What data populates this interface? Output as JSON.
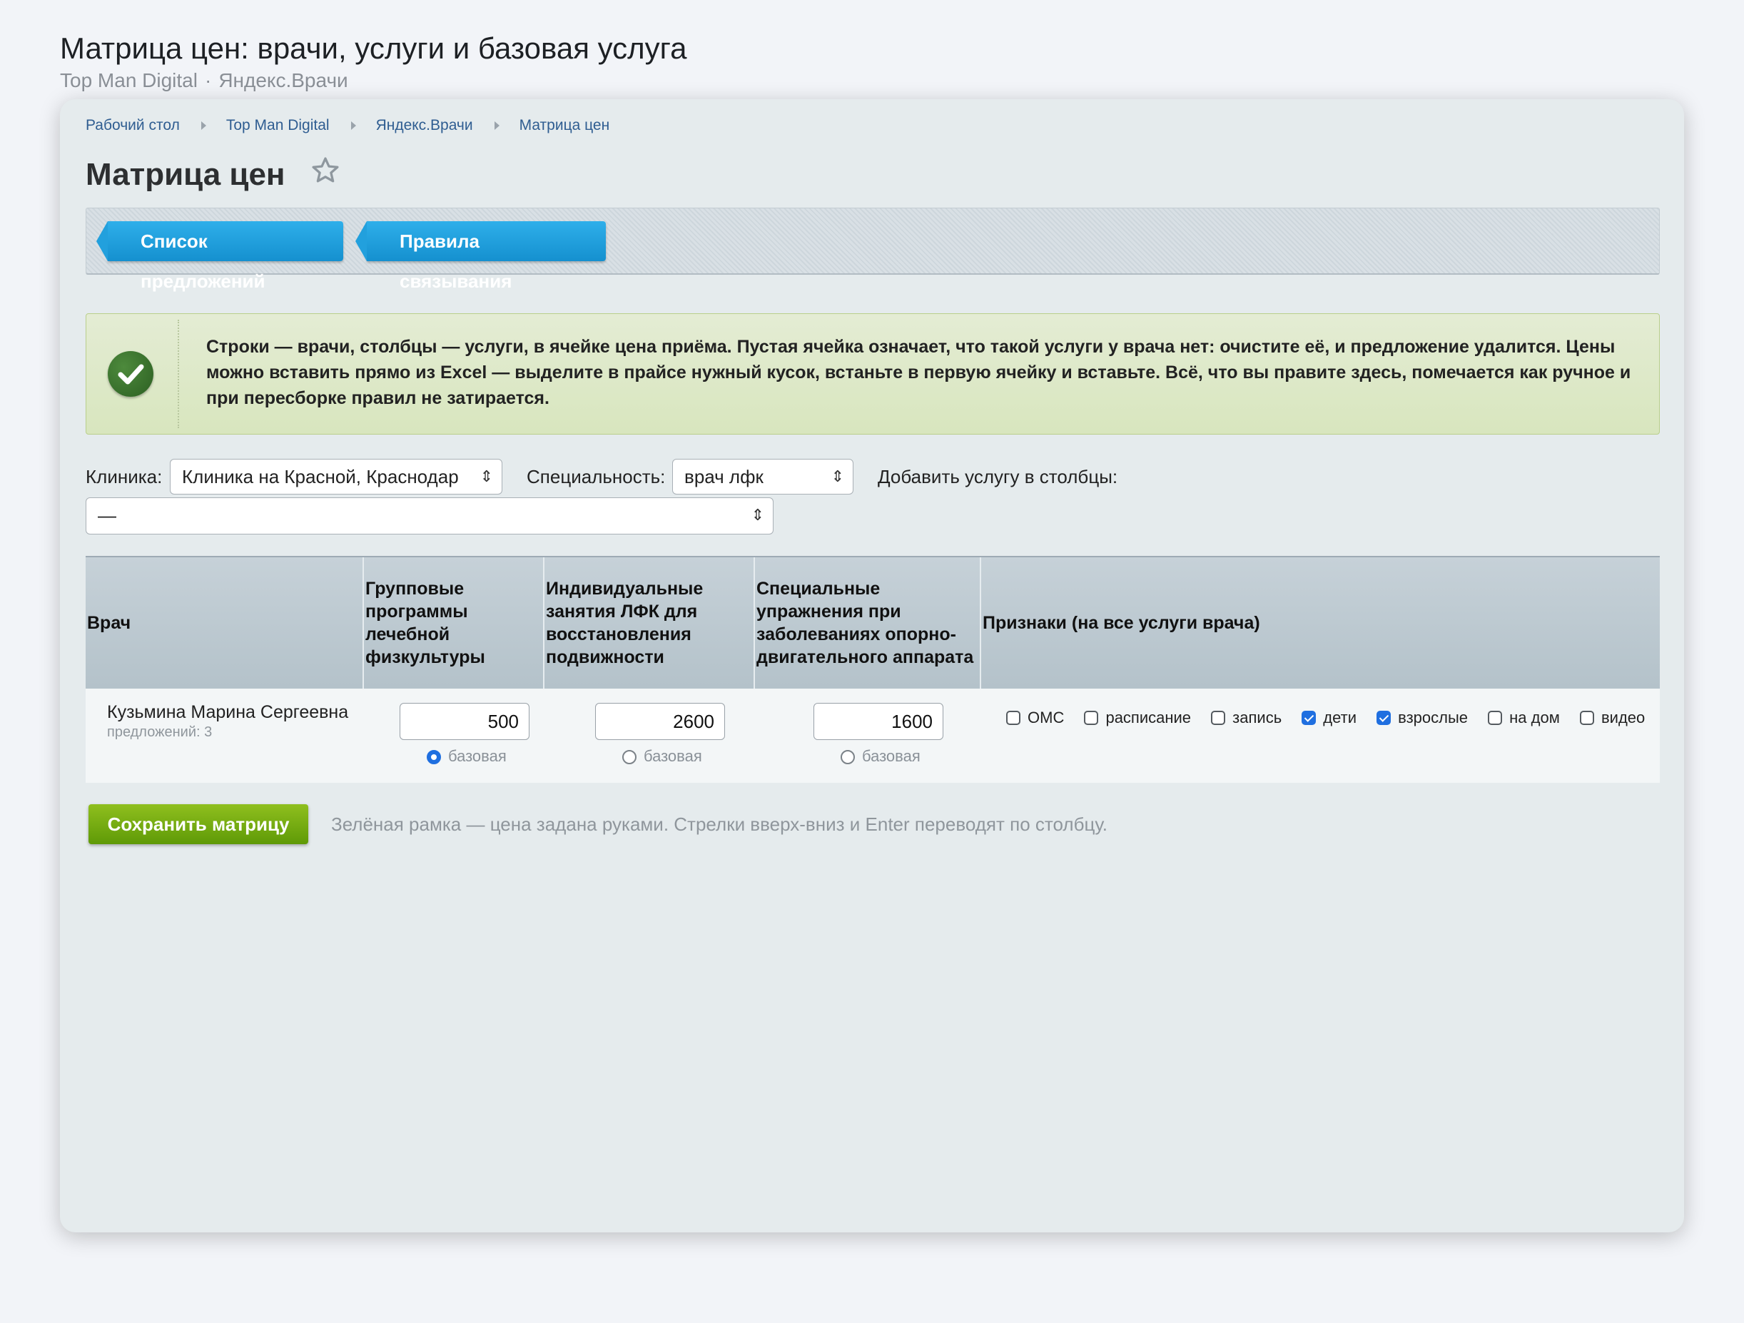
{
  "page": {
    "title": "Матрица цен: врачи, услуги и базовая услуга",
    "subtitle_parts": [
      "Top Man Digital",
      "·",
      "Яндекс.Врачи"
    ]
  },
  "breadcrumbs": [
    "Рабочий стол",
    "Top Man Digital",
    "Яндекс.Врачи",
    "Матрица цен"
  ],
  "heading": "Матрица цен",
  "icons": {
    "favorite": "star-outline-icon",
    "notice": "check-circle-icon",
    "crumb_sep": "triangle-right-icon"
  },
  "tabs": [
    {
      "label": "Список предложений"
    },
    {
      "label": "Правила связывания"
    }
  ],
  "notice": {
    "text": "Строки — врачи, столбцы — услуги, в ячейке цена приёма. Пустая ячейка означает, что такой услуги у врача нет: очистите её, и предложение удалится. Цены можно вставить прямо из Excel — выделите в прайсе нужный кусок, встаньте в первую ячейку и вставьте. Всё, что вы правите здесь, помечается как ручное и при пересборке правил не затирается."
  },
  "filters": {
    "clinic_label": "Клиника:",
    "clinic_value": "Клиника на Красной, Краснодар",
    "specialty_label": "Специальность:",
    "specialty_value": "врач лфк",
    "add_service_label": "Добавить услугу в столбцы:",
    "add_service_value": "—"
  },
  "table": {
    "headers": {
      "doctor": "Врач",
      "col1": "Групповые программы лечебной физкультуры",
      "col2": "Индивидуальные занятия ЛФК для восстановления подвижности",
      "col3": "Специальные упражнения при заболеваниях опорно-двигательного аппарата",
      "flags": "Признаки (на все услуги врача)"
    },
    "rows": [
      {
        "doctor": "Кузьмина Марина Сергеевна",
        "offers": "предложений: 3",
        "prices": [
          "500",
          "2600",
          "1600"
        ],
        "base_label": "базовая",
        "base_selected_index": 0,
        "flags": [
          {
            "label": "ОМС",
            "checked": false
          },
          {
            "label": "расписание",
            "checked": false
          },
          {
            "label": "запись",
            "checked": false
          },
          {
            "label": "дети",
            "checked": true
          },
          {
            "label": "взрослые",
            "checked": true
          },
          {
            "label": "на дом",
            "checked": false
          },
          {
            "label": "видео",
            "checked": false
          }
        ]
      }
    ]
  },
  "actions": {
    "save_label": "Сохранить матрицу",
    "hint": "Зелёная рамка — цена задана руками. Стрелки вверх-вниз и Enter переводят по столбцу."
  },
  "colors": {
    "tab_blue": "#1d9ee0",
    "save_green": "#74ab12",
    "notice_bg": "#dfe9c9",
    "checkbox_blue": "#1f6fe0"
  }
}
